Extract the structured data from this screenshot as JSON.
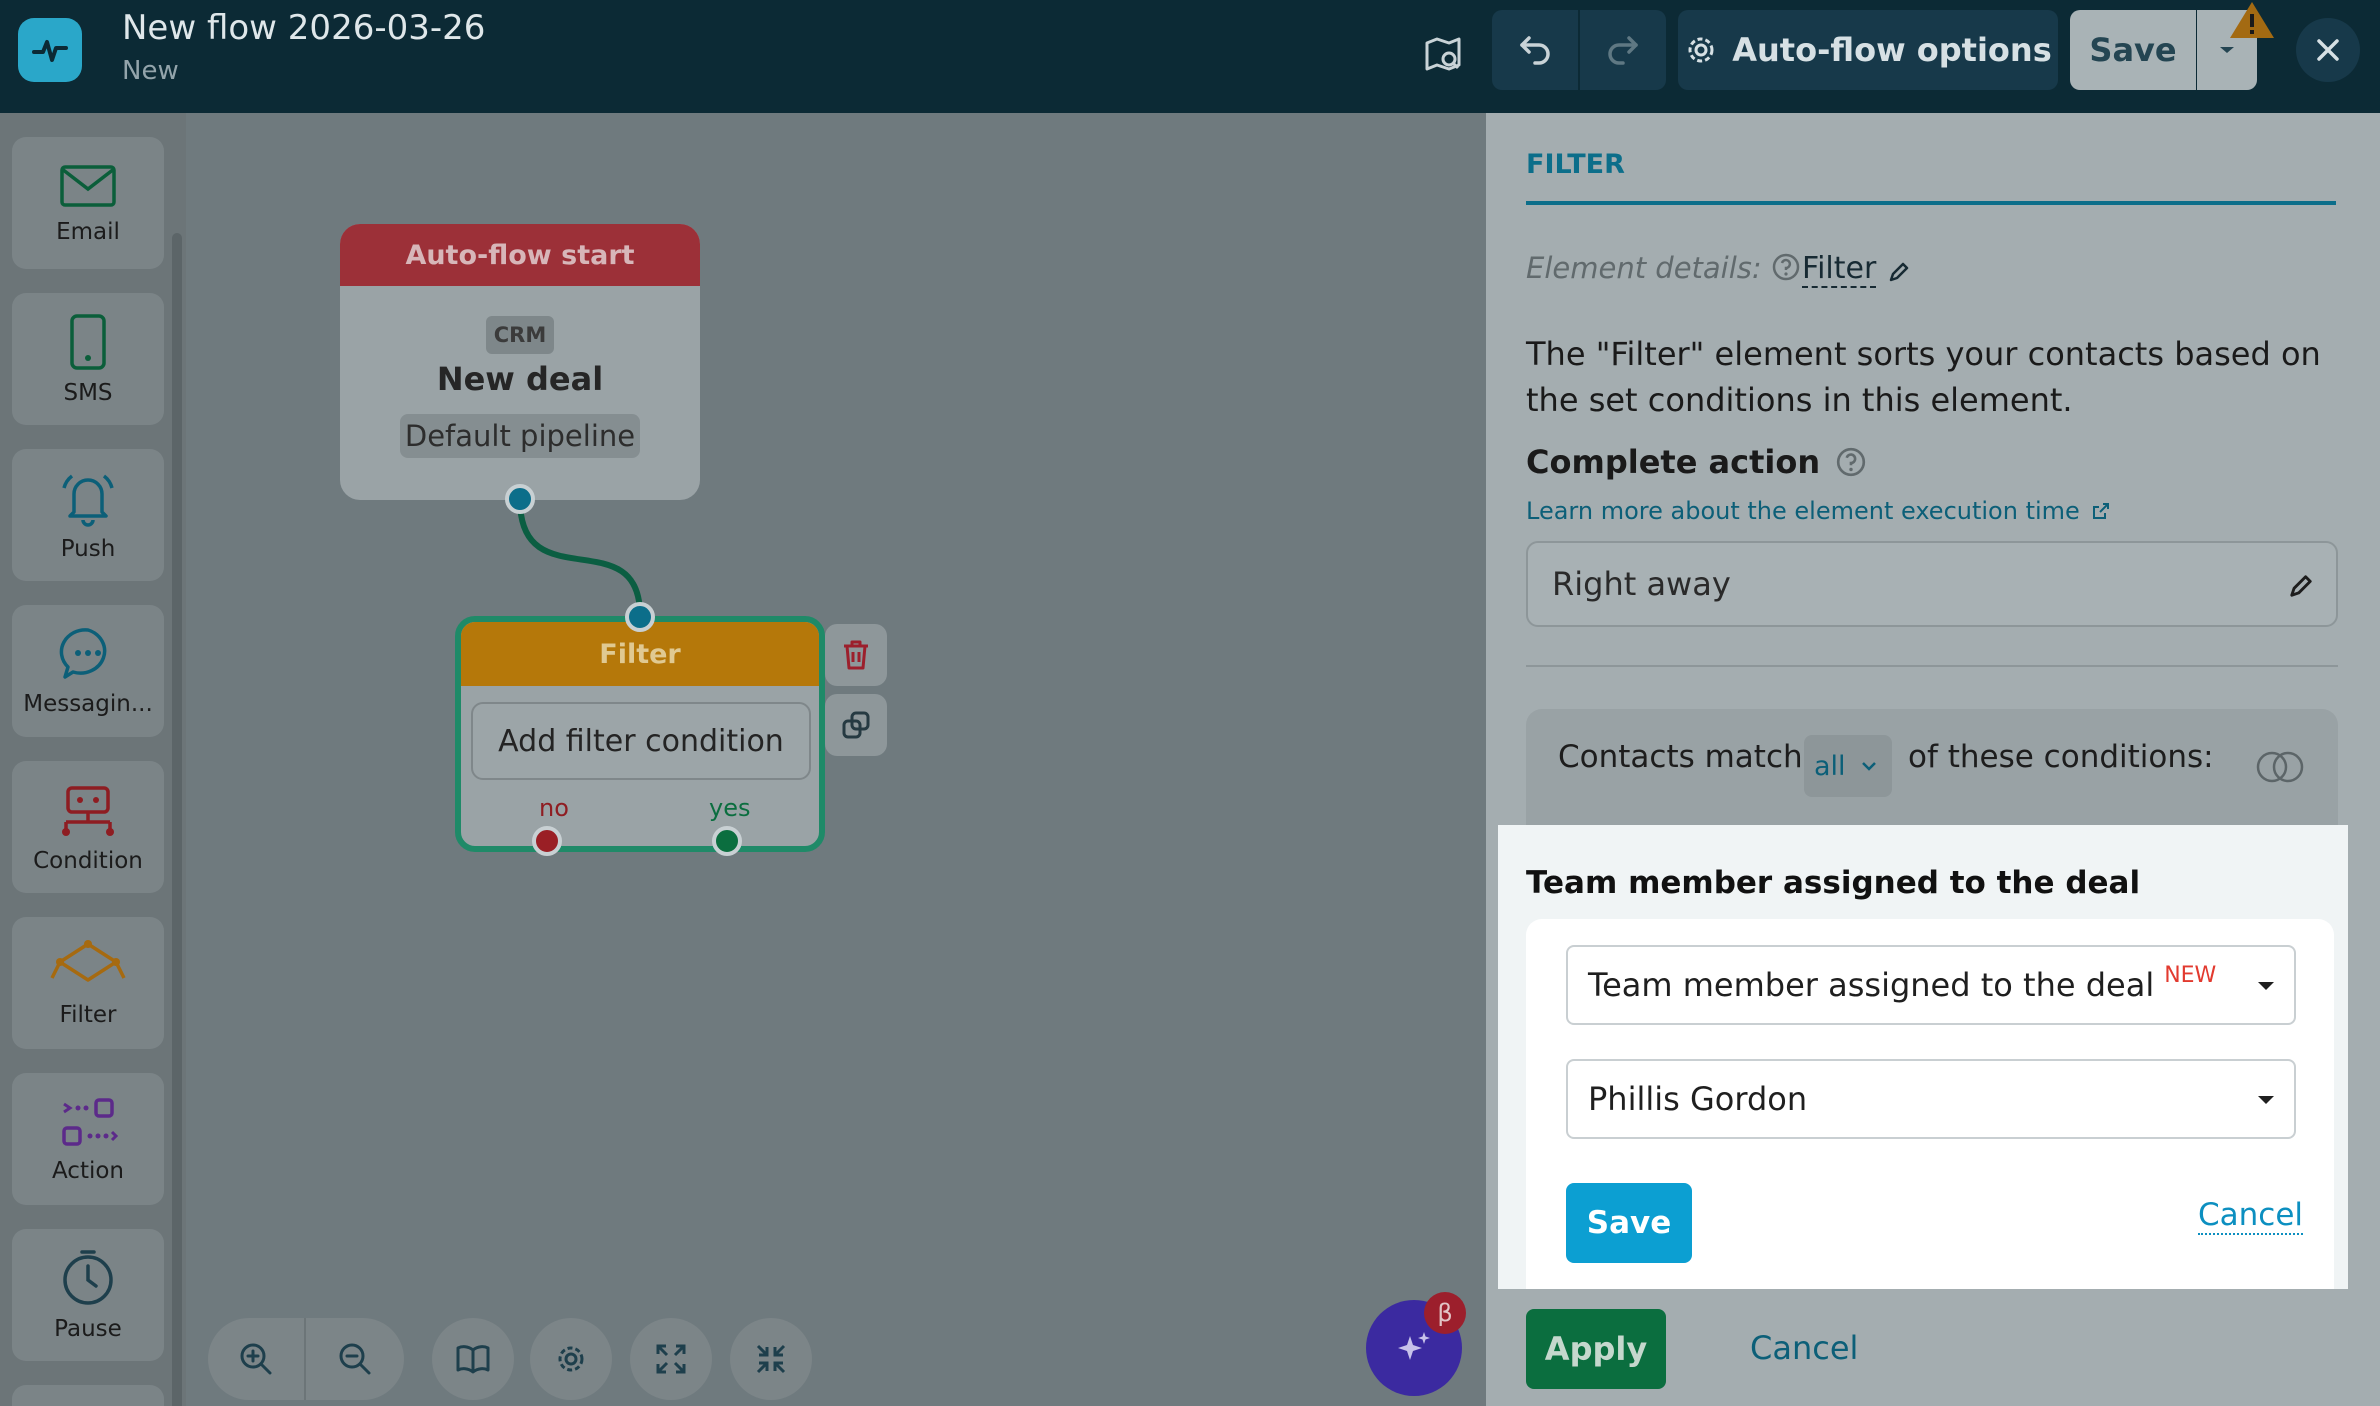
{
  "topbar": {
    "flow_title": "New flow 2026-03-26",
    "flow_status": "New",
    "autoflow_options_label": "Auto-flow options",
    "save_label": "Save"
  },
  "sidebar": {
    "items": [
      {
        "label": "Email",
        "icon": "email-icon"
      },
      {
        "label": "SMS",
        "icon": "sms-icon"
      },
      {
        "label": "Push",
        "icon": "bell-icon"
      },
      {
        "label": "Messagin...",
        "icon": "chat-icon"
      },
      {
        "label": "Condition",
        "icon": "condition-icon"
      },
      {
        "label": "Filter",
        "icon": "filter-icon"
      },
      {
        "label": "Action",
        "icon": "action-icon"
      },
      {
        "label": "Pause",
        "icon": "clock-icon"
      }
    ]
  },
  "canvas": {
    "start_node": {
      "header": "Auto-flow start",
      "badge": "CRM",
      "title": "New deal",
      "subtitle": "Default pipeline"
    },
    "filter_node": {
      "header": "Filter",
      "add_condition": "Add filter condition",
      "no_label": "no",
      "yes_label": "yes"
    },
    "beta_badge": "β"
  },
  "panel": {
    "tab": "FILTER",
    "element_details_label": "Element details:",
    "element_name": "Filter",
    "description": "The \"Filter\" element sorts your contacts based on the set conditions in this element.",
    "complete_action_label": "Complete action",
    "learn_more_link": "Learn more about the element execution time",
    "complete_action_value": "Right away",
    "contacts_match_prefix": "Contacts match",
    "match_mode": "all",
    "contacts_match_suffix": "of these conditions:",
    "popup": {
      "title": "Team member assigned to the deal",
      "field_select": "Team member assigned to the deal",
      "new_tag": "NEW",
      "value_select": "Phillis Gordon",
      "save_label": "Save",
      "cancel_label": "Cancel"
    },
    "apply_label": "Apply",
    "cancel_label": "Cancel"
  },
  "colors": {
    "topbar_bg": "#0c2a35",
    "accent_blue": "#0c9fd2",
    "start_header": "#9c3038",
    "filter_header": "#b5780a",
    "apply_green": "#0b6e3f",
    "new_tag_red": "#e23a2f"
  }
}
